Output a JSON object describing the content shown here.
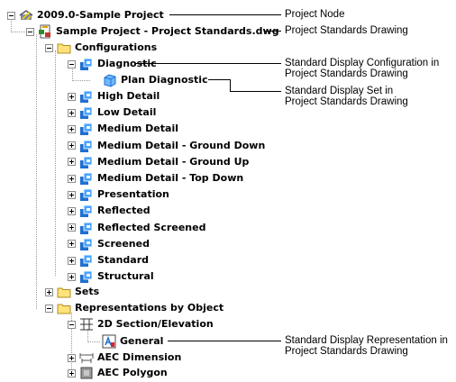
{
  "tree": {
    "project_node": "2009.0-Sample Project",
    "drawing": "Sample Project - Project Standards.dwg",
    "configurations": "Configurations",
    "diagnostic": "Diagnostic",
    "plan_diagnostic": "Plan Diagnostic",
    "config_items": [
      "High Detail",
      "Low Detail",
      "Medium Detail",
      "Medium Detail - Ground Down",
      "Medium Detail - Ground Up",
      "Medium Detail - Top Down",
      "Presentation",
      "Reflected",
      "Reflected Screened",
      "Screened",
      "Standard",
      "Structural"
    ],
    "sets": "Sets",
    "representations": "Representations by Object",
    "section_elevation": "2D Section/Elevation",
    "general": "General",
    "aec_dimension": "AEC Dimension",
    "aec_polygon": "AEC Polygon"
  },
  "callouts": {
    "project_node": "Project Node",
    "drawing": "Project Standards Drawing",
    "config_line1": "Standard Display Configuration in",
    "config_line2": "Project Standards Drawing",
    "set_line1": "Standard Display Set in",
    "set_line2": "Project Standards Drawing",
    "rep_line1": "Standard Display Representation in",
    "rep_line2": "Project Standards Drawing"
  },
  "icons": {
    "project": "project-icon",
    "drawing": "drawing-icon",
    "folder": "folder-icon",
    "display_config": "display-config-icon",
    "display_set": "display-set-icon",
    "section_elevation": "section-elevation-icon",
    "representation": "display-representation-icon",
    "dimension": "dimension-icon",
    "polygon": "polygon-icon"
  }
}
